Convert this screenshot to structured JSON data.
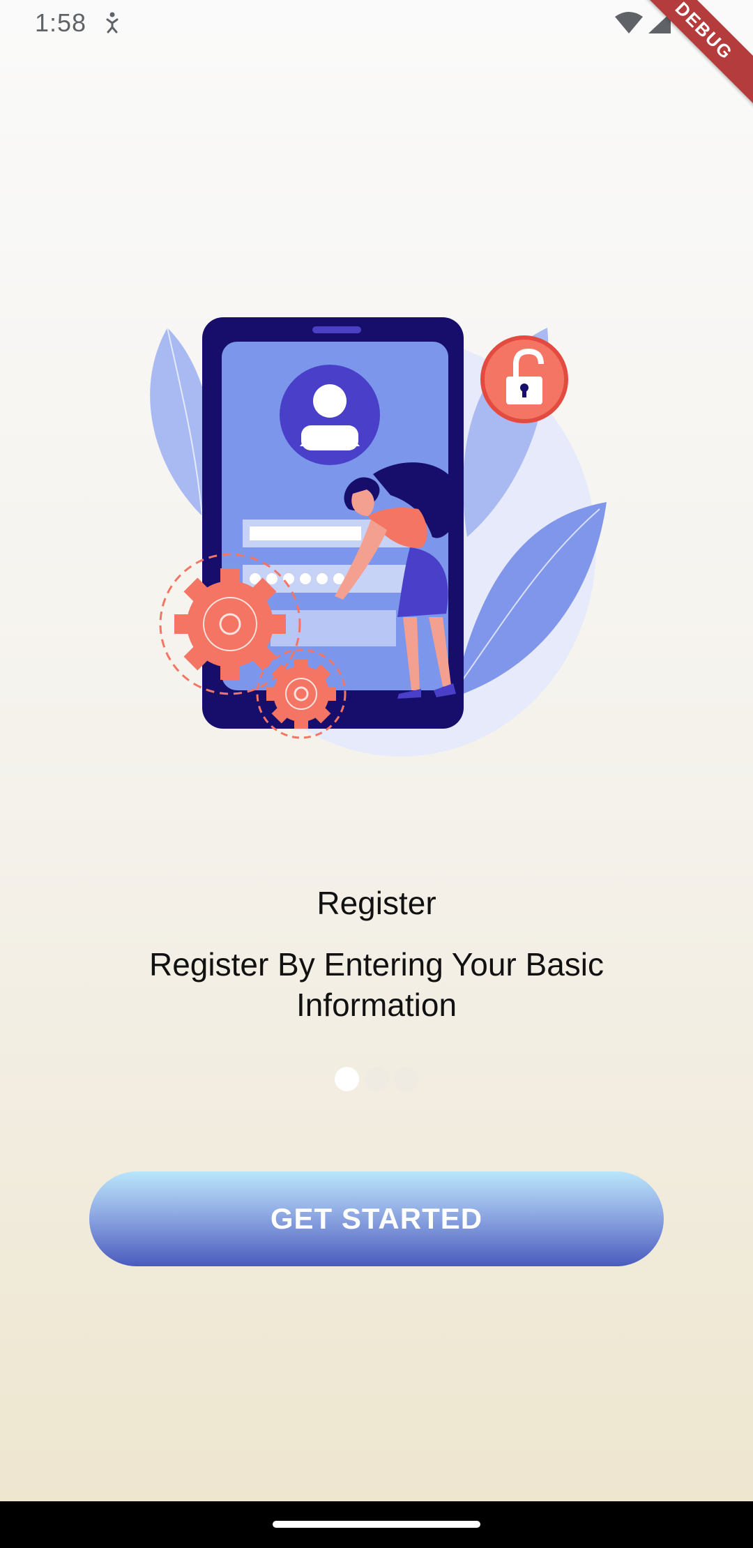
{
  "status_bar": {
    "time": "1:58",
    "notification_icon": "accessibility-icon",
    "wifi_icon": "wifi-icon",
    "signal_icon": "cell-signal-icon"
  },
  "debug_banner": {
    "label": "DEBUG",
    "color": "#b53c3c"
  },
  "illustration": {
    "subject": "registration-illustration"
  },
  "onboarding": {
    "title": "Register",
    "subtitle": "Register By Entering Your Basic Information",
    "page_indicator": {
      "total": 3,
      "current": 1
    }
  },
  "cta": {
    "label": "GET STARTED",
    "gradient_top": "#b9e6fb",
    "gradient_bottom": "#4a5bbd"
  },
  "colors": {
    "phone": "#170e6b",
    "screen": "#7b96ea",
    "accent_coral": "#f47563",
    "leaf": "#9db0ee"
  }
}
